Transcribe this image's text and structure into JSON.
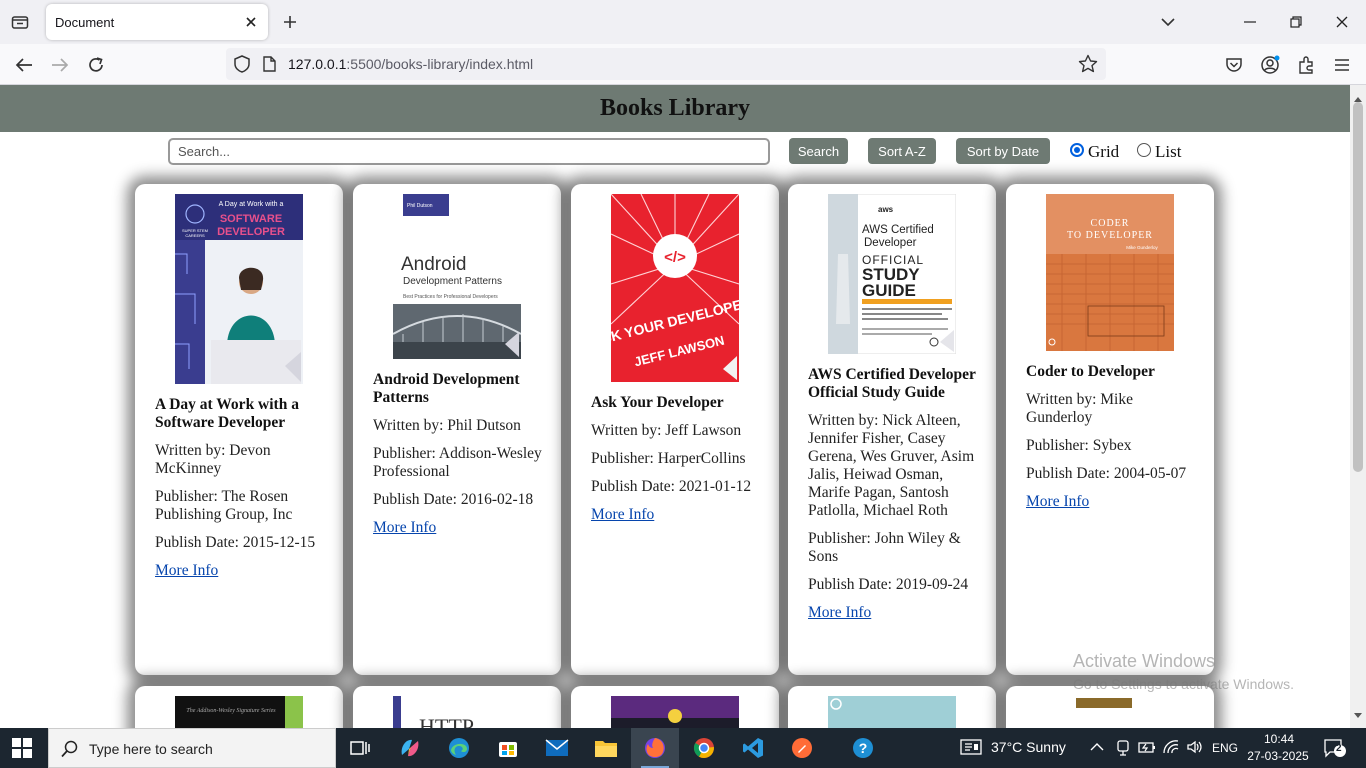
{
  "browser": {
    "tab_title": "Document",
    "url_host": "127.0.0.1",
    "url_rest": ":5500/books-library/index.html"
  },
  "page": {
    "title": "Books Library",
    "search_placeholder": "Search...",
    "search_label": "Search",
    "sort_az_label": "Sort A-Z",
    "sort_date_label": "Sort by Date",
    "view_options": [
      "Grid",
      "List"
    ],
    "selected_view": "Grid"
  },
  "books": [
    {
      "title": "A Day at Work with a Software Developer",
      "author": "Written by: Devon McKinney",
      "publisher": "Publisher: The Rosen Publishing Group, Inc",
      "date": "Publish Date: 2015-12-15",
      "link": "More Info",
      "cover": {
        "top": "A Day at Work with a",
        "big": "SOFTWARE DEVELOPER",
        "side": "SUPER STEM CAREERS"
      }
    },
    {
      "title": "Android Development Patterns",
      "author": "Written by: Phil Dutson",
      "publisher": "Publisher: Addison-Wesley Professional",
      "date": "Publish Date: 2016-02-18",
      "link": "More Info",
      "cover": {
        "tag": "Phil Dutson",
        "big": "Android",
        "sub": "Development Patterns",
        "small": "Best Practices for Professional Developers"
      }
    },
    {
      "title": "Ask Your Developer",
      "author": "Written by: Jeff Lawson",
      "publisher": "Publisher: HarperCollins",
      "date": "Publish Date: 2021-01-12",
      "link": "More Info",
      "cover": {
        "big": "ASK YOUR DEVELOPER",
        "author": "JEFF LAWSON",
        "code": "</>"
      }
    },
    {
      "title": "AWS Certified Developer Official Study Guide",
      "author": "Written by: Nick Alteen, Jennifer Fisher, Casey Gerena, Wes Gruver, Asim Jalis, Heiwad Osman, Marife Pagan, Santosh Patlolla, Michael Roth",
      "publisher": "Publisher: John Wiley & Sons",
      "date": "Publish Date: 2019-09-24",
      "link": "More Info",
      "cover": {
        "brand": "aws",
        "l1": "AWS Certified",
        "l2": "Developer",
        "l3": "OFFICIAL",
        "l4": "STUDY",
        "l5": "GUIDE"
      }
    },
    {
      "title": "Coder to Developer",
      "author": "Written by: Mike Gunderloy",
      "publisher": "Publisher: Sybex",
      "date": "Publish Date: 2004-05-07",
      "link": "More Info",
      "cover": {
        "l1": "CODER",
        "l2": "TO DEVELOPER",
        "author": "Mike Gunderloy"
      }
    }
  ],
  "row2_covers": [
    {
      "text": "The Addison-Wesley Signature Series"
    },
    {
      "text": "HTTP"
    },
    {
      "text": ""
    },
    {
      "text": ""
    },
    {
      "text": ""
    }
  ],
  "watermark": {
    "line1": "Activate Windows",
    "line2": "Go to Settings to activate Windows."
  },
  "taskbar": {
    "search_placeholder": "Type here to search",
    "weather": "37°C  Sunny",
    "lang": "ENG",
    "time": "10:44",
    "date": "27-03-2025",
    "notifications": "2"
  }
}
